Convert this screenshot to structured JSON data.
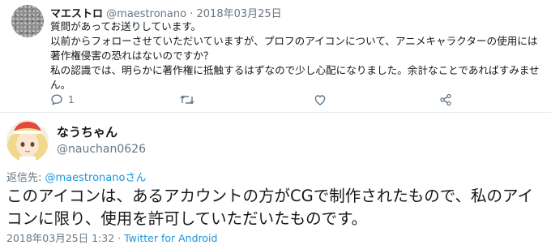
{
  "tweet1": {
    "display_name": "マエストロ",
    "handle": "@maestronano",
    "separator": "·",
    "date": "2018年03月25日",
    "lines": [
      "質問があってお送りしています。",
      "以前からフォローさせていただいていますが、プロフのアイコンについて、アニメキャラクターの使用には著作権侵害の恐れはないのですか？",
      "私の認識では、明らかに著作権に抵触するはずなので少し心配になりました。余計なことであればすみません。"
    ],
    "actions": {
      "reply_count": "1",
      "reply_icon": "reply-icon",
      "retweet_icon": "retweet-icon",
      "like_icon": "heart-icon",
      "share_icon": "share-icon"
    }
  },
  "tweet2": {
    "display_name": "なうちゃん",
    "handle": "@nauchan0626",
    "reply_prefix": "返信先: ",
    "reply_mention": "@maestronano",
    "reply_suffix": "さん",
    "body": "このアイコンは、あるアカウントの方がCGで制作されたもので、私のアイコンに限り、使用を許可していただいたものです。",
    "timestamp": "2018年03月25日 1:32 · ",
    "client": "Twitter for Android"
  },
  "colors": {
    "accent": "#1b95e0",
    "muted": "#657786",
    "text": "#14171a",
    "divider": "#e6ecf0"
  }
}
